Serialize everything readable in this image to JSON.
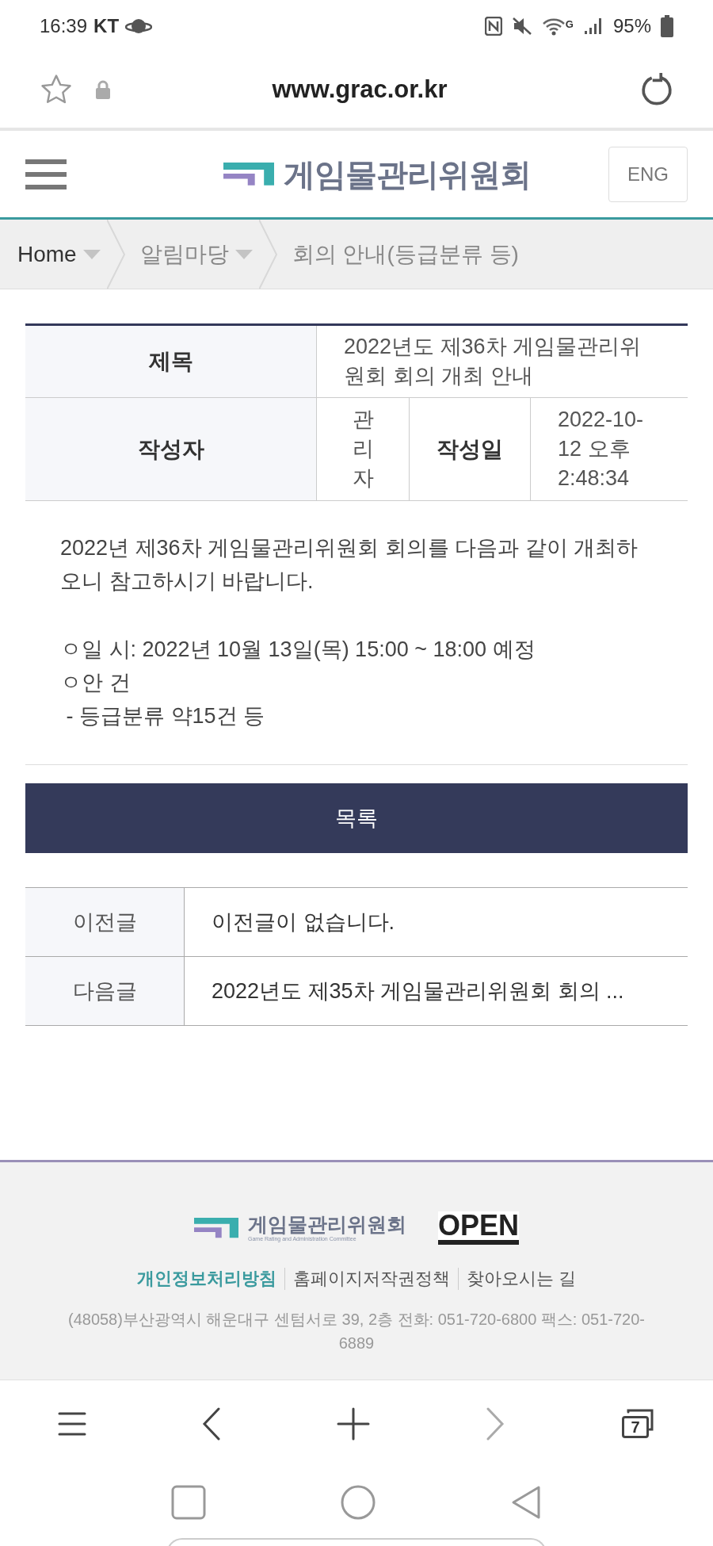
{
  "status_bar": {
    "time": "16:39",
    "carrier": "KT",
    "battery": "95%",
    "network": "G"
  },
  "browser": {
    "url": "www.grac.or.kr",
    "tab_count": "7"
  },
  "header": {
    "logo_text": "게임물관리위원회",
    "lang_button": "ENG"
  },
  "breadcrumb": [
    "Home",
    "알림마당",
    "회의 안내(등급분류 등)"
  ],
  "post": {
    "title_label": "제목",
    "title": "2022년도 제36차 게임물관리위원회 회의 개최 안내",
    "author_label": "작성자",
    "author": "관리자",
    "date_label": "작성일",
    "date": "2022-10-12 오후 2:48:34"
  },
  "body": {
    "intro": "2022년 제36차 게임물관리위원회 회의를 다음과 같이 개최하오니 참고하시기 바랍니다.",
    "lines": [
      "ㅇ일 시: 2022년 10월 13일(목) 15:00 ~ 18:00 예정",
      "ㅇ안 건",
      " - 등급분류 약15건 등"
    ]
  },
  "list_button": "목록",
  "nav_posts": [
    {
      "label": "이전글",
      "text": "이전글이 없습니다."
    },
    {
      "label": "다음글",
      "text": "2022년도 제35차 게임물관리위원회 회의 ..."
    }
  ],
  "footer": {
    "logo_text": "게임물관리위원회",
    "logo_subtitle": "Game Rating and Administration Committee",
    "open_badge": "OPEN",
    "links": [
      {
        "label": "개인정보처리방침",
        "highlighted": true
      },
      {
        "label": "홈페이지저작권정책",
        "highlighted": false
      },
      {
        "label": "찾아오시는 길",
        "highlighted": false
      }
    ],
    "address": "(48058)부산광역시 해운대구 센텀서로 39, 2층 전화: 051-720-6800 팩스: 051-720-6889"
  }
}
